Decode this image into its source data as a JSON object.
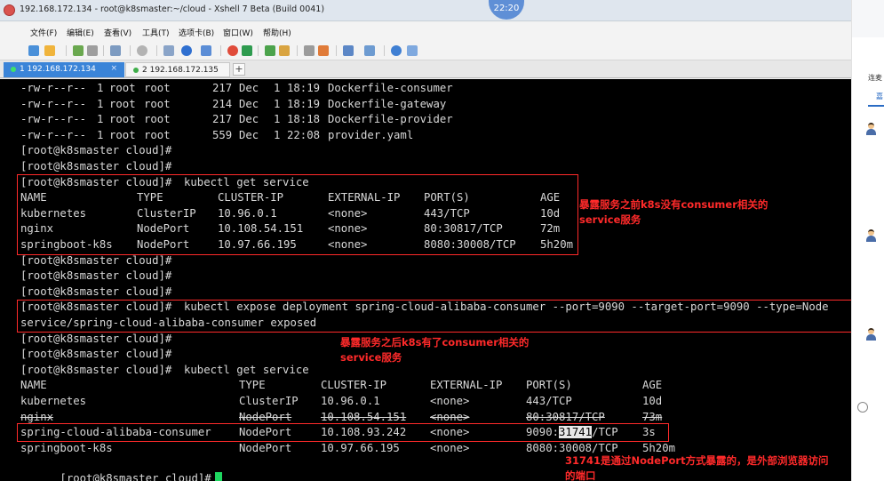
{
  "window": {
    "title": "192.168.172.134 - root@k8smaster:~/cloud - Xshell 7 Beta (Build 0041)",
    "clock": "22:20"
  },
  "menu": [
    "文件(F)",
    "编辑(E)",
    "查看(V)",
    "工具(T)",
    "选项卡(B)",
    "窗口(W)",
    "帮助(H)"
  ],
  "tabs": {
    "active": "1 192.168.172.134",
    "inactive": "2 192.168.172.135",
    "close_glyph": "×",
    "add_glyph": "+"
  },
  "colors": {
    "terminal_bg": "#000000",
    "terminal_fg": "#d8d8d8",
    "annotation": "#ff2a2a",
    "active_tab": "#3a84d8",
    "cursor": "#1ed760"
  },
  "terminal": {
    "files": [
      {
        "perm": "-rw-r--r--",
        "links": "1",
        "owner": "root",
        "group": "root",
        "size": "217",
        "month": "Dec",
        "day": "1",
        "time": "18:19",
        "name": "Dockerfile-consumer"
      },
      {
        "perm": "-rw-r--r--",
        "links": "1",
        "owner": "root",
        "group": "root",
        "size": "214",
        "month": "Dec",
        "day": "1",
        "time": "18:19",
        "name": "Dockerfile-gateway"
      },
      {
        "perm": "-rw-r--r--",
        "links": "1",
        "owner": "root",
        "group": "root",
        "size": "217",
        "month": "Dec",
        "day": "1",
        "time": "18:18",
        "name": "Dockerfile-provider"
      },
      {
        "perm": "-rw-r--r--",
        "links": "1",
        "owner": "root",
        "group": "root",
        "size": "559",
        "month": "Dec",
        "day": "1",
        "time": "22:08",
        "name": "provider.yaml"
      }
    ],
    "prompt": "[root@k8smaster cloud]#",
    "cmd_get_service": "kubectl get service",
    "cmd_expose": "kubectl expose deployment spring-cloud-alibaba-consumer --port=9090 --target-port=9090 --type=Node",
    "expose_output": "service/spring-cloud-alibaba-consumer exposed",
    "table_headers": [
      "NAME",
      "TYPE",
      "CLUSTER-IP",
      "EXTERNAL-IP",
      "PORT(S)",
      "AGE"
    ],
    "services_before": [
      [
        "kubernetes",
        "ClusterIP",
        "10.96.0.1",
        "<none>",
        "443/TCP",
        "10d"
      ],
      [
        "nginx",
        "NodePort",
        "10.108.54.151",
        "<none>",
        "80:30817/TCP",
        "72m"
      ],
      [
        "springboot-k8s",
        "NodePort",
        "10.97.66.195",
        "<none>",
        "8080:30008/TCP",
        "5h20m"
      ]
    ],
    "services_after": [
      [
        "kubernetes",
        "ClusterIP",
        "10.96.0.1",
        "<none>",
        "443/TCP",
        "10d"
      ],
      [
        "nginx",
        "NodePort",
        "10.108.54.151",
        "<none>",
        "80:30817/TCP",
        "73m"
      ],
      [
        "spring-cloud-alibaba-consumer",
        "NodePort",
        "10.108.93.242",
        "<none>",
        "9090:",
        "3s"
      ],
      [
        "springboot-k8s",
        "NodePort",
        "10.97.66.195",
        "<none>",
        "8080:30008/TCP",
        "5h20m"
      ]
    ],
    "highlighted_port": "31741",
    "highlighted_port_suffix": "/TCP"
  },
  "annotations": {
    "before_1": "暴露服务之前k8s没有consumer相关的",
    "before_2": "service服务",
    "after_1": "暴露服务之后k8s有了consumer相关的",
    "after_2": "service服务",
    "port_1": "31741是通过NodePort方式暴露的，是外部浏览器访问",
    "port_2": "的端口"
  },
  "side_panel": {
    "text": "连麦",
    "tab": "嘉"
  }
}
